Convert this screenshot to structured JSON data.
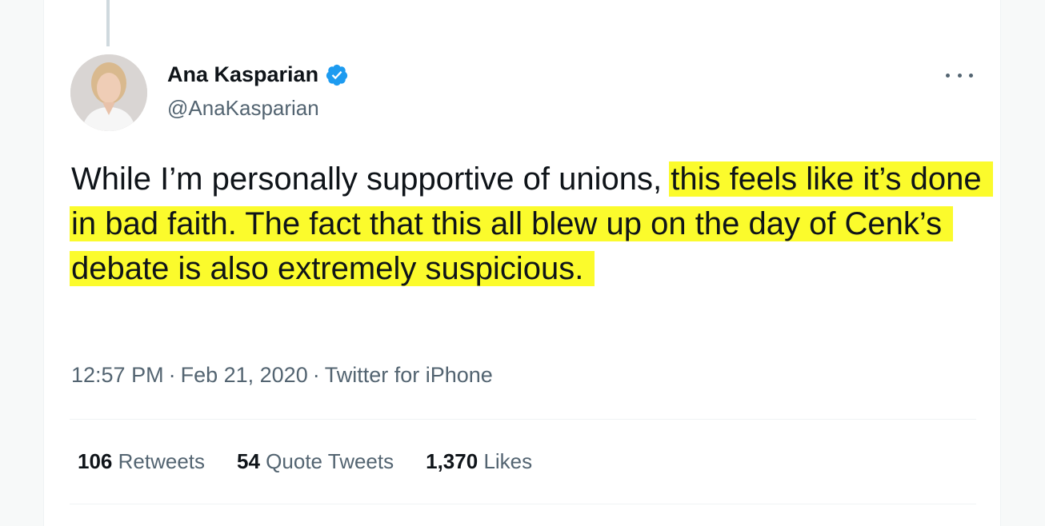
{
  "author": {
    "display_name": "Ana Kasparian",
    "handle": "@AnaKasparian",
    "verified_icon": "verified-badge-icon"
  },
  "tweet": {
    "text_plain": "While I’m personally supportive of unions,",
    "text_highlighted": "this feels like it’s done in bad faith. The fact that this all blew up on the day of Cenk’s debate is also extremely suspicious."
  },
  "meta": {
    "time": "12:57 PM",
    "date": "Feb 21, 2020",
    "source": "Twitter for iPhone",
    "separator": "·"
  },
  "stats": {
    "retweets": {
      "count": "106",
      "label": "Retweets"
    },
    "quotes": {
      "count": "54",
      "label": "Quote Tweets"
    },
    "likes": {
      "count": "1,370",
      "label": "Likes"
    }
  },
  "colors": {
    "highlight": "#fbfb2c",
    "verified": "#1d9bf0",
    "text_primary": "#0f1419",
    "text_secondary": "#536471"
  }
}
